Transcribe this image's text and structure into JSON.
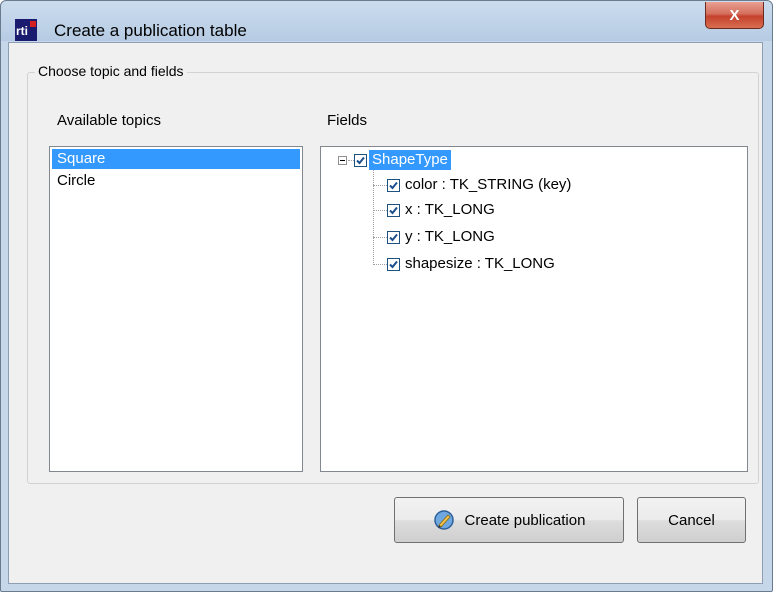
{
  "window": {
    "title": "Create a publication table",
    "close_label": "X"
  },
  "groupbox": {
    "legend": "Choose topic and fields"
  },
  "topics": {
    "header": "Available topics",
    "items": [
      {
        "label": "Square",
        "selected": true
      },
      {
        "label": "Circle",
        "selected": false
      }
    ]
  },
  "fields": {
    "header": "Fields",
    "root": {
      "label": "ShapeType",
      "checked": true
    },
    "children": [
      {
        "label": "color : TK_STRING (key)",
        "checked": true
      },
      {
        "label": "x : TK_LONG",
        "checked": true
      },
      {
        "label": "y : TK_LONG",
        "checked": true
      },
      {
        "label": "shapesize : TK_LONG",
        "checked": true
      }
    ]
  },
  "buttons": {
    "create_label": "Create publication",
    "cancel_label": "Cancel"
  },
  "colors": {
    "selection": "#3399ff",
    "close_button": "#c4412d"
  }
}
